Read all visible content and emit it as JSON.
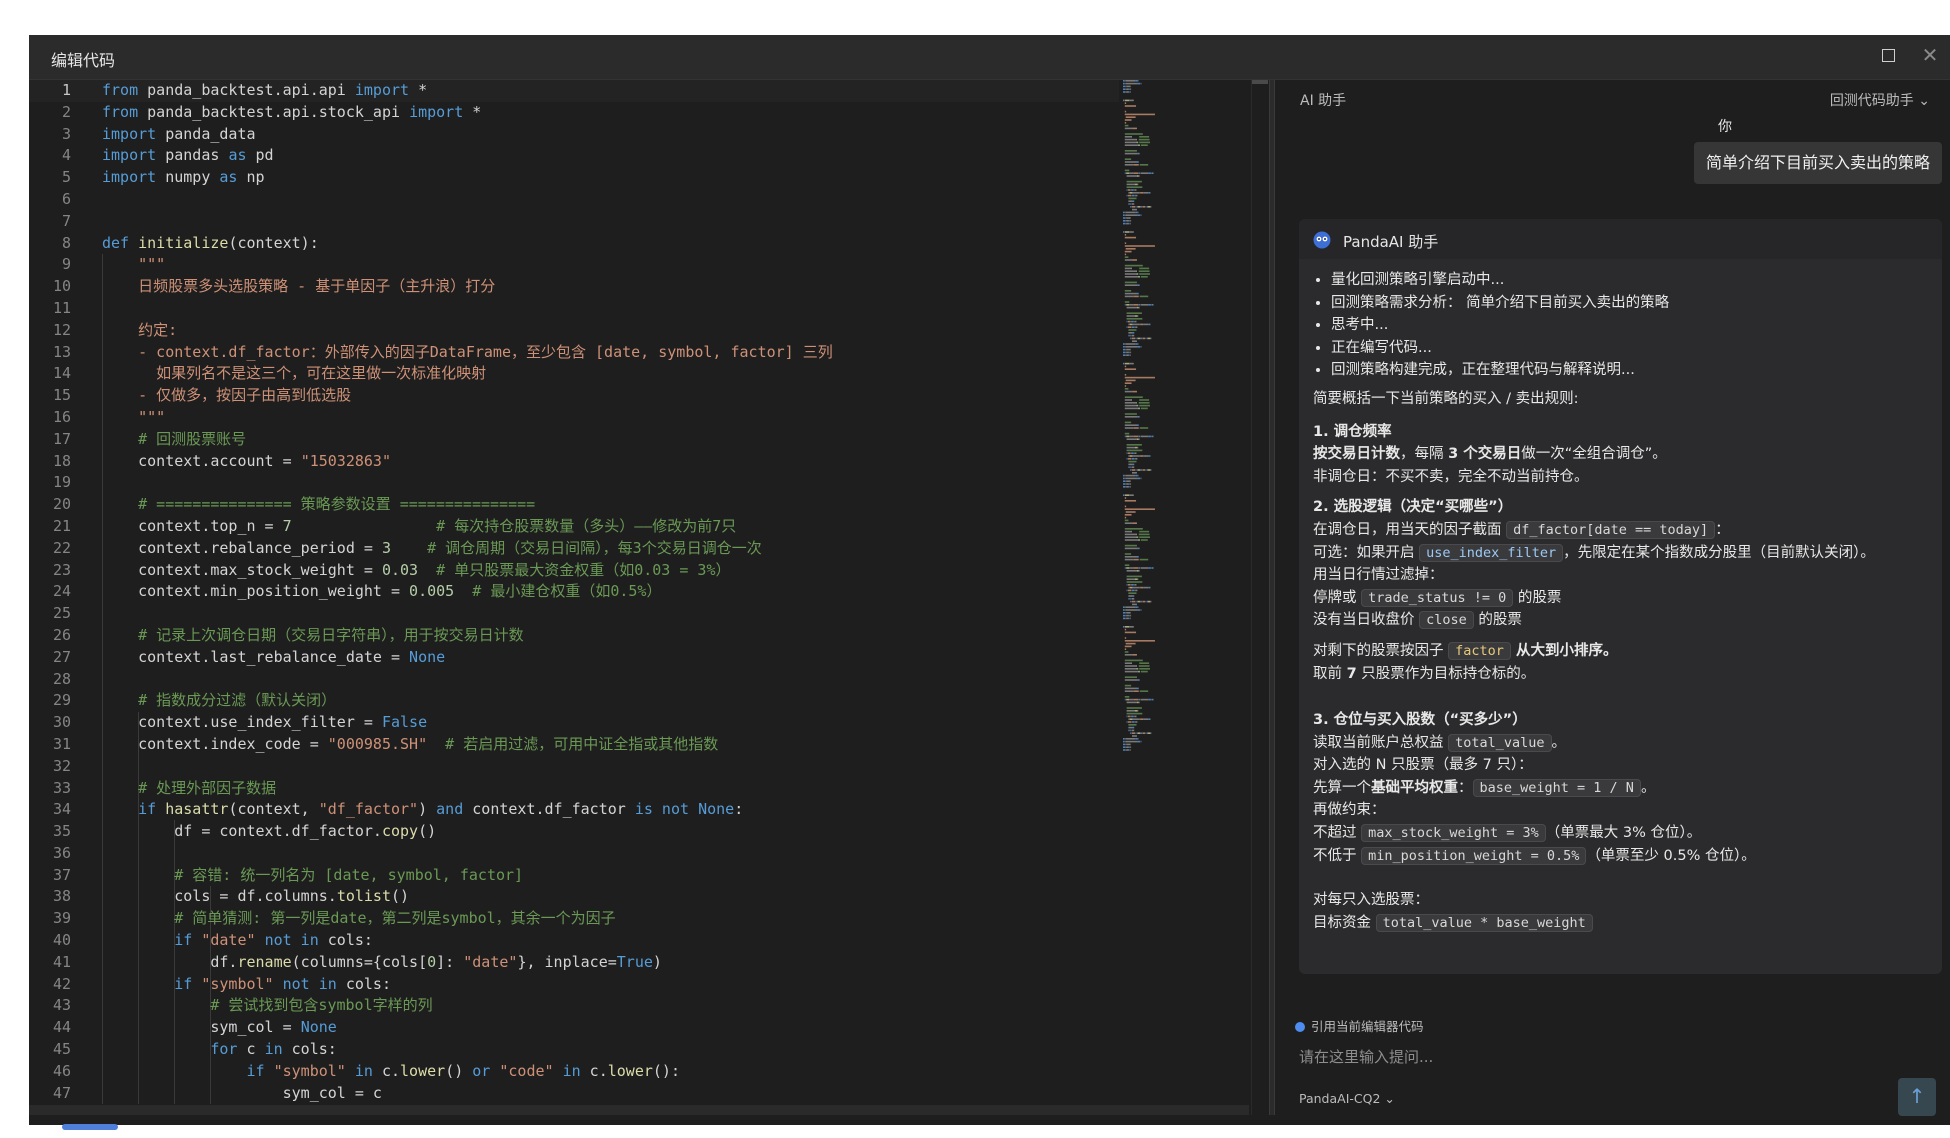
{
  "window": {
    "title": "编辑代码"
  },
  "assistant": {
    "panel_title": "AI 助手",
    "mode": "回测代码助手",
    "user_label": "你",
    "user_message": "简单介绍下目前买入卖出的策略",
    "ai_name": "PandaAI 助手",
    "steps": [
      "量化回测策略引擎启动中...",
      "回测策略需求分析： 简单介绍下目前买入卖出的策略",
      "思考中...",
      "正在编写代码...",
      "回测策略构建完成，正在整理代码与解释说明..."
    ],
    "intro": "简要概括一下当前策略的买入 / 卖出规则:",
    "s1_title": "1. 调仓频率",
    "s1_l1_a": "按交易日计数",
    "s1_l1_b": "，每隔 ",
    "s1_l1_c": "3 个交易日",
    "s1_l1_d": "做一次“全组合调仓”。",
    "s1_l2": "非调仓日：不买不卖，完全不动当前持仓。",
    "s2_title": "2. 选股逻辑（决定“买哪些”）",
    "s2_l1_a": "在调仓日，用当天的因子截面 ",
    "s2_l1_code": "df_factor[date == today]",
    "s2_l1_b": "：",
    "s2_l2_a": "可选：如果开启 ",
    "s2_l2_code": "use_index_filter",
    "s2_l2_b": "，先限定在某个指数成分股里（目前默认关闭）。",
    "s2_l3": "用当日行情过滤掉：",
    "s2_l4_a": "停牌或 ",
    "s2_l4_code": "trade_status != 0",
    "s2_l4_b": " 的股票",
    "s2_l5_a": "没有当日收盘价 ",
    "s2_l5_code": "close",
    "s2_l5_b": " 的股票",
    "s2_l6_a": "对剩下的股票按因子 ",
    "s2_l6_code": "factor",
    "s2_l6_b": " 从大到小排序。",
    "s2_l7_a": "取前 ",
    "s2_l7_b": "7",
    "s2_l7_c": " 只股票作为目标持仓标的。",
    "s3_title": "3. 仓位与买入股数（“买多少”）",
    "s3_l1_a": "读取当前账户总权益 ",
    "s3_l1_code": "total_value",
    "s3_l1_b": "。",
    "s3_l2": "对入选的 N 只股票（最多 7 只）：",
    "s3_l3_a": "先算一个",
    "s3_l3_b": "基础平均权重",
    "s3_l3_c": "：",
    "s3_l3_code": "base_weight = 1 / N",
    "s3_l3_d": "。",
    "s3_l4": "再做约束：",
    "s3_l5_a": "不超过 ",
    "s3_l5_code": "max_stock_weight = 3%",
    "s3_l5_b": "（单票最大 3% 仓位）。",
    "s3_l6_a": "不低于 ",
    "s3_l6_code": "min_position_weight = 0.5%",
    "s3_l6_b": "（单票至少 0.5% 仓位）。",
    "s3_l7": "对每只入选股票：",
    "s3_l8_a": "目标资金 ",
    "s3_l8_code": "total_value * base_weight",
    "ref_label": "引用当前编辑器代码",
    "input_placeholder": "请在这里输入提问...",
    "model": "PandaAI-CQ2",
    "send_icon": "arrow-up-icon"
  },
  "code_lines": [
    [
      [
        "kw",
        "from"
      ],
      [
        "pl",
        " panda_backtest.api.api "
      ],
      [
        "kw",
        "import"
      ],
      [
        "pl",
        " *"
      ]
    ],
    [
      [
        "kw",
        "from"
      ],
      [
        "pl",
        " panda_backtest.api.stock_api "
      ],
      [
        "kw",
        "import"
      ],
      [
        "pl",
        " *"
      ]
    ],
    [
      [
        "kw",
        "import"
      ],
      [
        "pl",
        " panda_data"
      ]
    ],
    [
      [
        "kw",
        "import"
      ],
      [
        "pl",
        " pandas "
      ],
      [
        "kw",
        "as"
      ],
      [
        "pl",
        " pd"
      ]
    ],
    [
      [
        "kw",
        "import"
      ],
      [
        "pl",
        " numpy "
      ],
      [
        "kw",
        "as"
      ],
      [
        "pl",
        " np"
      ]
    ],
    [],
    [],
    [
      [
        "kw",
        "def"
      ],
      [
        "pl",
        " "
      ],
      [
        "fn",
        "initialize"
      ],
      [
        "pl",
        "(context):"
      ]
    ],
    [
      [
        "doc",
        "    \"\"\""
      ]
    ],
    [
      [
        "doc",
        "    日频股票多头选股策略 - 基于单因子（主升浪）打分"
      ]
    ],
    [],
    [
      [
        "doc",
        "    约定:"
      ]
    ],
    [
      [
        "doc",
        "    - context.df_factor：外部传入的因子DataFrame，至少包含 [date, symbol, factor] 三列"
      ]
    ],
    [
      [
        "doc",
        "      如果列名不是这三个，可在这里做一次标准化映射"
      ]
    ],
    [
      [
        "doc",
        "    - 仅做多，按因子由高到低选股"
      ]
    ],
    [
      [
        "doc",
        "    \"\"\""
      ]
    ],
    [
      [
        "com",
        "    # 回测股票账号"
      ]
    ],
    [
      [
        "pl",
        "    context.account = "
      ],
      [
        "str",
        "\"15032863\""
      ]
    ],
    [],
    [
      [
        "com",
        "    # =============== 策略参数设置 ==============="
      ]
    ],
    [
      [
        "pl",
        "    context.top_n = "
      ],
      [
        "num",
        "7"
      ],
      [
        "com",
        "                # 每次持仓股票数量（多头）——修改为前7只"
      ]
    ],
    [
      [
        "pl",
        "    context.rebalance_period = "
      ],
      [
        "num",
        "3"
      ],
      [
        "com",
        "    # 调仓周期（交易日间隔），每3个交易日调仓一次"
      ]
    ],
    [
      [
        "pl",
        "    context.max_stock_weight = "
      ],
      [
        "num",
        "0.03"
      ],
      [
        "com",
        "  # 单只股票最大资金权重（如0.03 = 3%）"
      ]
    ],
    [
      [
        "pl",
        "    context.min_position_weight = "
      ],
      [
        "num",
        "0.005"
      ],
      [
        "com",
        "  # 最小建仓权重（如0.5%）"
      ]
    ],
    [],
    [
      [
        "com",
        "    # 记录上次调仓日期（交易日字符串），用于按交易日计数"
      ]
    ],
    [
      [
        "pl",
        "    context.last_rebalance_date = "
      ],
      [
        "kw",
        "None"
      ]
    ],
    [],
    [
      [
        "com",
        "    # 指数成分过滤（默认关闭）"
      ]
    ],
    [
      [
        "pl",
        "    context.use_index_filter = "
      ],
      [
        "kw",
        "False"
      ]
    ],
    [
      [
        "pl",
        "    context.index_code = "
      ],
      [
        "str",
        "\"000985.SH\""
      ],
      [
        "com",
        "  # 若启用过滤，可用中证全指或其他指数"
      ]
    ],
    [],
    [
      [
        "com",
        "    # 处理外部因子数据"
      ]
    ],
    [
      [
        "kw",
        "    if"
      ],
      [
        "pl",
        " "
      ],
      [
        "fn",
        "hasattr"
      ],
      [
        "pl",
        "(context, "
      ],
      [
        "str",
        "\"df_factor\""
      ],
      [
        "pl",
        ") "
      ],
      [
        "kw",
        "and"
      ],
      [
        "pl",
        " context.df_factor "
      ],
      [
        "kw",
        "is not"
      ],
      [
        "pl",
        " "
      ],
      [
        "kw",
        "None"
      ],
      [
        "pl",
        ":"
      ]
    ],
    [
      [
        "pl",
        "        df = context.df_factor."
      ],
      [
        "fn",
        "copy"
      ],
      [
        "pl",
        "()"
      ]
    ],
    [],
    [
      [
        "com",
        "        # 容错: 统一列名为 [date, symbol, factor]"
      ]
    ],
    [
      [
        "pl",
        "        cols = df.columns."
      ],
      [
        "fn",
        "tolist"
      ],
      [
        "pl",
        "()"
      ]
    ],
    [
      [
        "com",
        "        # 简单猜测: 第一列是date，第二列是symbol，其余一个为因子"
      ]
    ],
    [
      [
        "kw",
        "        if"
      ],
      [
        "pl",
        " "
      ],
      [
        "str",
        "\"date\""
      ],
      [
        "pl",
        " "
      ],
      [
        "kw",
        "not in"
      ],
      [
        "pl",
        " cols:"
      ]
    ],
    [
      [
        "pl",
        "            df."
      ],
      [
        "fn",
        "rename"
      ],
      [
        "pl",
        "(columns={cols["
      ],
      [
        "num",
        "0"
      ],
      [
        "pl",
        "]: "
      ],
      [
        "str",
        "\"date\""
      ],
      [
        "pl",
        "}, inplace="
      ],
      [
        "kw",
        "True"
      ],
      [
        "pl",
        ")"
      ]
    ],
    [
      [
        "kw",
        "        if"
      ],
      [
        "pl",
        " "
      ],
      [
        "str",
        "\"symbol\""
      ],
      [
        "pl",
        " "
      ],
      [
        "kw",
        "not in"
      ],
      [
        "pl",
        " cols:"
      ]
    ],
    [
      [
        "com",
        "            # 尝试找到包含symbol字样的列"
      ]
    ],
    [
      [
        "pl",
        "            sym_col = "
      ],
      [
        "kw",
        "None"
      ]
    ],
    [
      [
        "kw",
        "            for"
      ],
      [
        "pl",
        " c "
      ],
      [
        "kw",
        "in"
      ],
      [
        "pl",
        " cols:"
      ]
    ],
    [
      [
        "kw",
        "                if"
      ],
      [
        "pl",
        " "
      ],
      [
        "str",
        "\"symbol\""
      ],
      [
        "pl",
        " "
      ],
      [
        "kw",
        "in"
      ],
      [
        "pl",
        " c."
      ],
      [
        "fn",
        "lower"
      ],
      [
        "pl",
        "() "
      ],
      [
        "kw",
        "or"
      ],
      [
        "pl",
        " "
      ],
      [
        "str",
        "\"code\""
      ],
      [
        "pl",
        " "
      ],
      [
        "kw",
        "in"
      ],
      [
        "pl",
        " c."
      ],
      [
        "fn",
        "lower"
      ],
      [
        "pl",
        "():"
      ]
    ],
    [
      [
        "pl",
        "                    sym_col = c"
      ]
    ]
  ]
}
